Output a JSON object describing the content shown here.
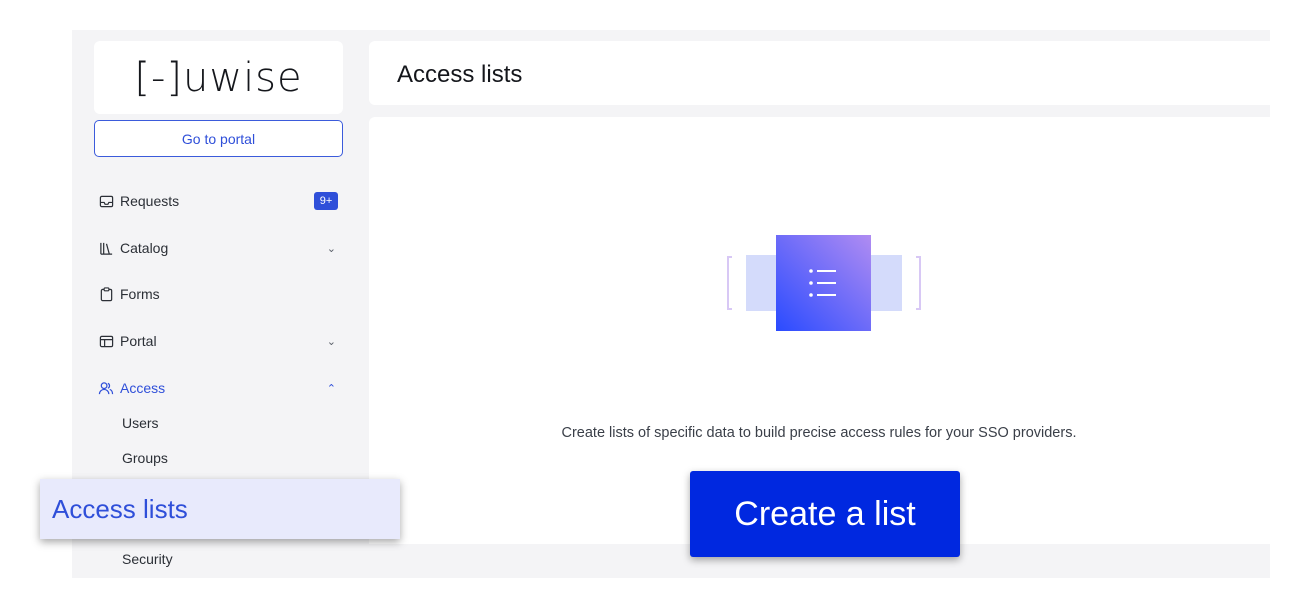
{
  "brand": {
    "logo_text": "[-]uwise"
  },
  "sidebar": {
    "portal_button": "Go to portal",
    "items": [
      {
        "label": "Requests",
        "icon": "inbox-icon",
        "badge": "9+"
      },
      {
        "label": "Catalog",
        "icon": "books-icon",
        "chevron": "⌄"
      },
      {
        "label": "Forms",
        "icon": "clipboard-icon"
      },
      {
        "label": "Portal",
        "icon": "browser-window-icon",
        "chevron": "⌄"
      },
      {
        "label": "Access",
        "icon": "users-icon",
        "chevron": "⌃"
      }
    ],
    "sub_items": [
      "Users",
      "Groups",
      "Access lists",
      "Security"
    ]
  },
  "header": {
    "title": "Access lists"
  },
  "main": {
    "description": "Create lists of specific data to build precise access rules for your SSO providers.",
    "create_button": "Create a list"
  },
  "zoom": {
    "label": "Access lists",
    "button": "Create a list"
  },
  "colors": {
    "accent": "#2f4fd9",
    "button": "#0028e0",
    "background": "#f4f4f6"
  }
}
